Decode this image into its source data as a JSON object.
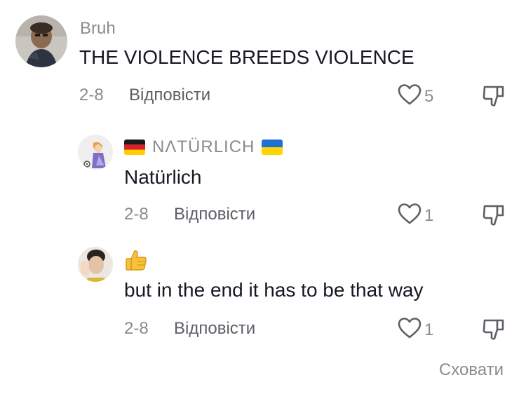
{
  "comments": [
    {
      "username": "Bruh",
      "text": "THE VIOLENCE BREEDS VIOLENCE",
      "date": "2-8",
      "reply_label": "Відповісти",
      "likes": "5"
    },
    {
      "username": "NΛTÜRLICH",
      "text": "Natürlich",
      "date": "2-8",
      "reply_label": "Відповісти",
      "likes": "1"
    },
    {
      "username": "",
      "text": "but in the end it has to be that way",
      "date": "2-8",
      "reply_label": "Відповісти",
      "likes": "1"
    }
  ],
  "footer": {
    "hide_label": "Сховати"
  },
  "colors": {
    "meta_gray": "#8a8b91",
    "reply_gray": "#5e5f66",
    "text": "#161823"
  }
}
